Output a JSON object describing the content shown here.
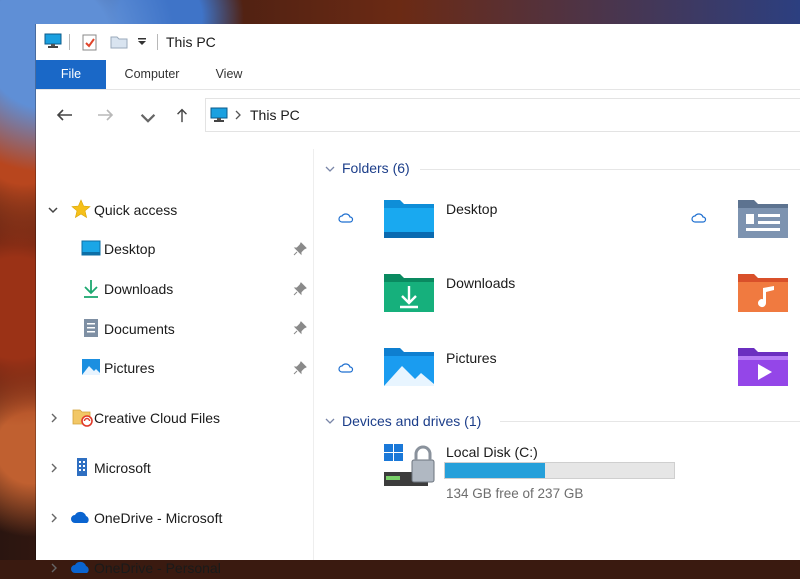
{
  "window": {
    "title": "This PC"
  },
  "ribbon": {
    "tabs": [
      {
        "label": "File",
        "active": true
      },
      {
        "label": "Computer"
      },
      {
        "label": "View"
      }
    ]
  },
  "address": {
    "path": [
      "This PC"
    ]
  },
  "nav_pane": {
    "quick_access": {
      "label": "Quick access",
      "items": [
        {
          "label": "Desktop",
          "icon": "desktop-icon",
          "pinned": true
        },
        {
          "label": "Downloads",
          "icon": "download-icon",
          "pinned": true
        },
        {
          "label": "Documents",
          "icon": "documents-icon",
          "pinned": true
        },
        {
          "label": "Pictures",
          "icon": "pictures-icon",
          "pinned": true
        }
      ]
    },
    "roots": [
      {
        "label": "Creative Cloud Files",
        "icon": "creative-cloud-icon"
      },
      {
        "label": "Microsoft",
        "icon": "building-icon"
      },
      {
        "label": "OneDrive - Microsoft",
        "icon": "onedrive-icon"
      },
      {
        "label": "OneDrive - Personal",
        "icon": "onedrive-icon"
      }
    ]
  },
  "folders_section": {
    "header": "Folders (6)",
    "items": [
      {
        "label": "Desktop",
        "icon": "desktop-folder-icon",
        "cloud": true
      },
      {
        "label": "Downloads",
        "icon": "downloads-folder-icon",
        "cloud": false
      },
      {
        "label": "Pictures",
        "icon": "pictures-folder-icon",
        "cloud": true
      },
      {
        "label": "",
        "icon": "documents-folder-icon",
        "cloud": true
      },
      {
        "label": "",
        "icon": "music-folder-icon",
        "cloud": false
      },
      {
        "label": "",
        "icon": "videos-folder-icon",
        "cloud": false
      }
    ]
  },
  "devices_section": {
    "header": "Devices and drives (1)",
    "drives": [
      {
        "label": "Local Disk (C:)",
        "free_text": "134 GB free of 237 GB",
        "used_fraction": 0.435,
        "icon": "windows-drive-icon"
      }
    ]
  },
  "colors": {
    "accent": "#1a68c7",
    "drive_bar": "#26a0da",
    "section_header": "#1c3e8a"
  }
}
